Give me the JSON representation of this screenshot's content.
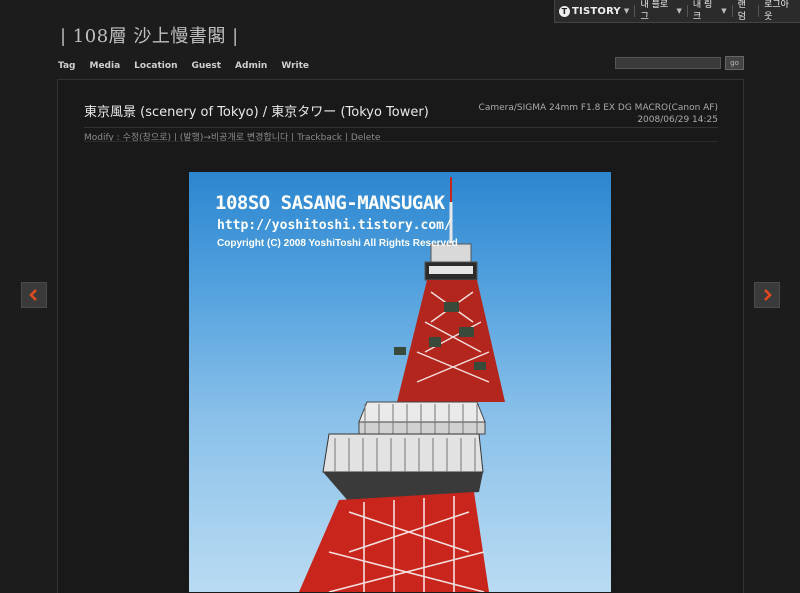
{
  "tistory_bar": {
    "logo_text": "TISTORY",
    "logo_badge": "T",
    "items": [
      {
        "label": "내 블로그",
        "has_caret": true
      },
      {
        "label": "내 링크",
        "has_caret": true
      },
      {
        "label": "랜덤",
        "has_caret": false
      },
      {
        "label": "로그아웃",
        "has_caret": false
      }
    ]
  },
  "site": {
    "title": "| 108層 沙上慢書閣 |"
  },
  "nav": [
    "Tag",
    "Media",
    "Location",
    "Guest",
    "Admin",
    "Write"
  ],
  "search": {
    "value": "",
    "button_label": "go"
  },
  "post": {
    "title": "東京風景 (scenery of Tokyo) / 東京タワー (Tokyo Tower)",
    "camera": "Camera/SIGMA 24mm F1.8 EX DG MACRO(Canon AF)",
    "datetime": "2008/06/29 14:25",
    "actions": [
      "Modify : 수정(창으로)",
      "(발행)→비공개로 변경합니다",
      "Trackback",
      "Delete"
    ]
  },
  "photo": {
    "watermark_title": "108SO SASANG-MANSUGAK",
    "watermark_url": "http://yoshitoshi.tistory.com/",
    "watermark_copyright": "Copyright (C) 2008 YoshiToshi All Rights Reserved"
  },
  "colors": {
    "background": "#1c1c1c",
    "arrow_accent": "#e24a1f",
    "sky_top": "#2c86cf",
    "tower_red": "#c8261c"
  },
  "icons": {
    "prev": "chevron-left-icon",
    "next": "chevron-right-icon"
  }
}
